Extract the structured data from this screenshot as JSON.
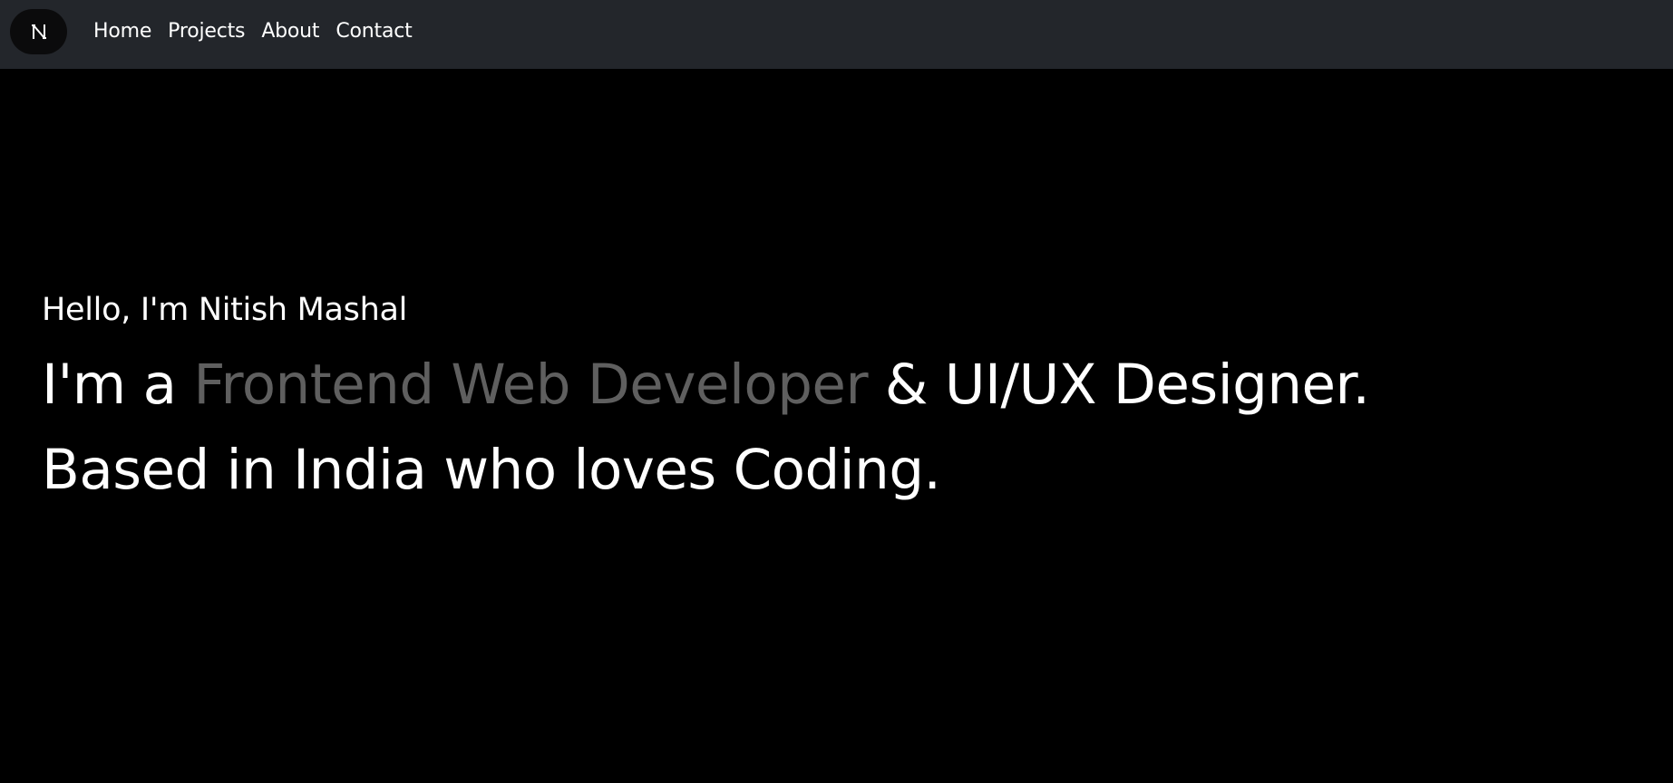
{
  "colors": {
    "background": "#000000",
    "navbar": "#23262b",
    "logo_bg": "#0b0b0c",
    "text": "#ffffff",
    "accent_text": "#5f5f5f"
  },
  "logo": {
    "icon": "n-monogram-icon"
  },
  "nav": {
    "items": [
      {
        "label": "Home"
      },
      {
        "label": "Projects"
      },
      {
        "label": "About"
      },
      {
        "label": "Contact"
      }
    ]
  },
  "hero": {
    "greeting": "Hello, I'm Nitish Mashal",
    "line1_prefix": "I'm a ",
    "line1_accent": "Frontend Web Developer",
    "line1_suffix": " & UI/UX Designer.",
    "line2": "Based in India who loves Coding."
  }
}
